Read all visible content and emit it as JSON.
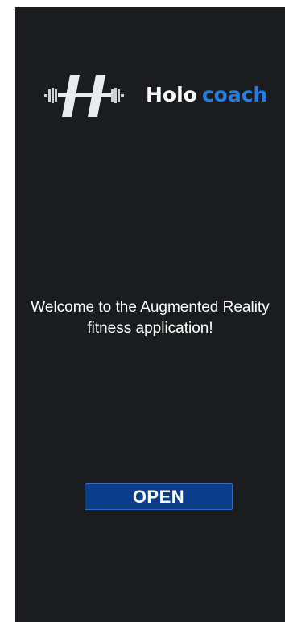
{
  "app": {
    "brand_primary": "Holo",
    "brand_secondary": "coach",
    "brand_secondary_color": "#1f7fe6",
    "logo_icon": "barbell-h-logo-icon"
  },
  "main": {
    "welcome_text": "Welcome to the Augmented Reality fitness application!",
    "open_label": "OPEN"
  },
  "colors": {
    "background": "#1a1c1f",
    "button": "#0b3d8c"
  }
}
